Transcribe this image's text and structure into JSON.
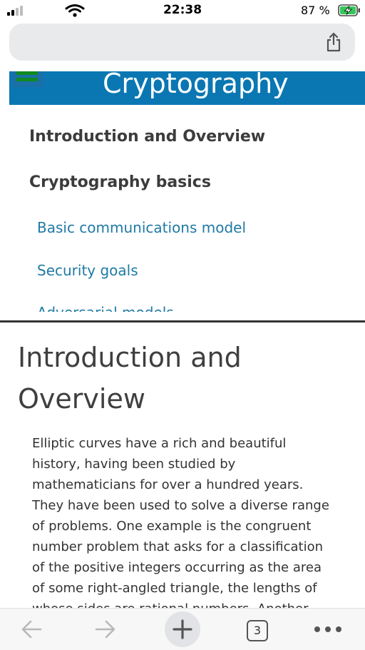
{
  "status_bar": {
    "time": "22:38",
    "battery_percent": "87 %",
    "signal_bars_active": 2,
    "icons": [
      "signal-icon",
      "wifi-icon",
      "battery-charging-icon"
    ]
  },
  "address_bar": {
    "share_icon": "share-icon"
  },
  "site_header": {
    "title": "Cryptography",
    "menu_icon": "hamburger-menu-icon",
    "background_color": "#0a77b3"
  },
  "toc": {
    "headings": [
      "Introduction and Overview",
      "Cryptography basics"
    ],
    "links": [
      "Basic communications model",
      "Security goals"
    ],
    "cut_off_text": "Adversarial models"
  },
  "article": {
    "title": "Introduction and Overview",
    "body": "Elliptic curves have a rich and beautiful history, having been studied by mathematicians for over a hundred years. They have been used to solve a diverse range of problems. One example is the congruent number problem that asks for a classification of the positive integers occurring as the area of some right-angled triangle, the lengths of whose sides are rational numbers. Another"
  },
  "toolbar": {
    "tab_count": "3",
    "icons": [
      "back-icon",
      "forward-icon",
      "new-tab-icon",
      "tabs-icon",
      "more-icon"
    ]
  },
  "colors": {
    "link": "#1f7aa5",
    "heading": "#3c3c3c",
    "menu_green": "#0f8a1f"
  }
}
